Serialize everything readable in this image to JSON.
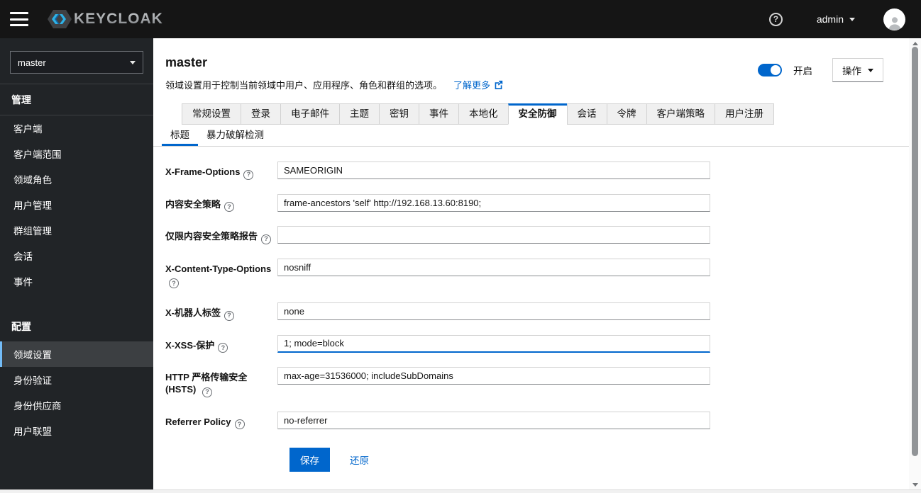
{
  "colors": {
    "accent": "#0066cc",
    "topbar_bg": "#151515",
    "sidebar_bg": "#212427",
    "selected_nav_bg": "#3c3f42",
    "nav_indicator": "#73bcf7"
  },
  "topbar": {
    "brand": "KEYCLOAK",
    "username": "admin"
  },
  "sidebar": {
    "realm_selector": {
      "value": "master"
    },
    "sections": [
      {
        "label": "管理",
        "items": [
          "客户端",
          "客户端范围",
          "领域角色",
          "用户管理",
          "群组管理",
          "会话",
          "事件"
        ]
      },
      {
        "label": "配置",
        "items": [
          "领域设置",
          "身份验证",
          "身份供应商",
          "用户联盟"
        ],
        "selected": "领域设置"
      }
    ]
  },
  "header": {
    "title": "master",
    "description": "领域设置用于控制当前领域中用户、应用程序、角色和群组的选项。",
    "learn_more": "了解更多",
    "enabled_toggle": {
      "state": "on",
      "label": "开启"
    },
    "actions_button": "操作"
  },
  "tabs": {
    "active": "安全防御",
    "items": [
      "常规设置",
      "登录",
      "电子邮件",
      "主题",
      "密钥",
      "事件",
      "本地化",
      "安全防御",
      "会话",
      "令牌",
      "客户端策略",
      "用户注册"
    ]
  },
  "subtabs": {
    "active": "标题",
    "items": [
      "标题",
      "暴力破解检测"
    ]
  },
  "form": {
    "fields": [
      {
        "label": "X-Frame-Options",
        "value": "SAMEORIGIN"
      },
      {
        "label": "内容安全策略",
        "value": "frame-ancestors 'self' http://192.168.13.60:8190;"
      },
      {
        "label": "仅限内容安全策略报告",
        "value": ""
      },
      {
        "label": "X-Content-Type-Options",
        "value": "nosniff"
      },
      {
        "label": "X-机器人标签",
        "value": "none"
      },
      {
        "label": "X-XSS-保护",
        "value": "1; mode=block"
      },
      {
        "label": "HTTP 严格传输安全 (HSTS)",
        "value": "max-age=31536000; includeSubDomains"
      },
      {
        "label": "Referrer Policy",
        "value": "no-referrer"
      }
    ],
    "save_label": "保存",
    "revert_label": "还原"
  }
}
